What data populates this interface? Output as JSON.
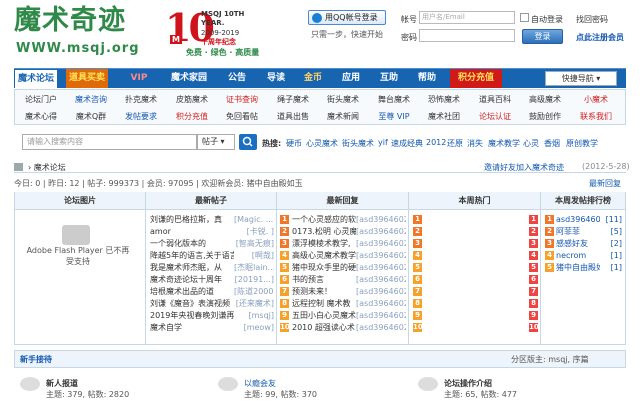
{
  "header": {
    "logo_cn": "魔术奇迹",
    "logo_url": "WWW.msqj.org",
    "anniv_num": "10",
    "anniv_m": "M",
    "anniv_t1": "MSQJ 10TH",
    "anniv_t2": "YEAR.",
    "anniv_t3": "2009-2019",
    "anniv_t4": "十周年纪念",
    "anniv_slogan": "免费 · 绿色 · 高质量",
    "qq_login": "用QQ帐号登录",
    "qq_hint": "只需一步，快速开始",
    "account_label": "帐号",
    "account_placeholder": "用户名/Email",
    "auto_login": "自动登录",
    "forgot": "找回密码",
    "password_label": "密码",
    "login_btn": "登录",
    "register": "点此注册会员"
  },
  "nav": {
    "items": [
      "魔术论坛",
      "道具买卖",
      "VIP",
      "魔术家园",
      "公告",
      "导读",
      "金币",
      "应用",
      "互助",
      "帮助",
      "积分充值"
    ],
    "quick": "快捷导航"
  },
  "subnav": {
    "row1": [
      "论坛门户",
      "魔术咨询",
      "扑克魔术",
      "皮筋魔术",
      "证书查询",
      "绳子魔术",
      "街头魔术",
      "舞台魔术",
      "恐怖魔术",
      "道具百科",
      "高级魔术",
      "小魔术"
    ],
    "row2": [
      "魔术心得",
      "魔术Q群",
      "发帖要求",
      "积分充值",
      "免回看帖",
      "道具出售",
      "魔术新闻",
      "至尊 VIP",
      "魔术社团",
      "论坛认证",
      "鼓励创作",
      "联系我们"
    ]
  },
  "search": {
    "placeholder": "请输入搜索内容",
    "type": "帖子",
    "hot_label": "热搜:",
    "hot": [
      "硬币",
      "心灵魔术",
      "街头魔术",
      "yif",
      "速成经典",
      "2012",
      "还原",
      "消失",
      "魔术教学",
      "心灵",
      "香烟",
      "原创教学"
    ]
  },
  "breadcrumb": {
    "path": "魔术论坛",
    "invite": "邀请好友加入魔术奇迹",
    "date": "(2012-5-28)"
  },
  "stats": {
    "text": "今日: 0 | 昨日: 12 | 帖子: 999373 | 会员: 97095 | 欢迎新会员: 猪中自由殿如玉",
    "latest": "最新回复"
  },
  "columns": [
    "论坛图片",
    "最新帖子",
    "最新回复",
    "本周热门",
    "本周发帖排行榜"
  ],
  "flash": "Adobe Flash Player 已不再受支持",
  "latest_posts": [
    {
      "t": "刘谦的巴格拉斯，真",
      "a": "[Magic. ...]"
    },
    {
      "t": "amor",
      "a": "[卡锐. ]"
    },
    {
      "t": "一个弱化版本的",
      "a": "[智高无痕]"
    },
    {
      "t": "降越5年的语言,关于语言.",
      "a": "[啊哉]"
    },
    {
      "t": "我是魔术师杰眠，从",
      "a": "[杰眠lain...]"
    },
    {
      "t": "魔术奇迹论坛十周年",
      "a": "[20191...]"
    },
    {
      "t": "培根魔术出品的道",
      "a": "[陈道2000]"
    },
    {
      "t": "刘谦《魔音》表演视频",
      "a": "[还来魔术]"
    },
    {
      "t": "2019年央视春晚刘谦再登.",
      "a": "[msqj]"
    },
    {
      "t": "魔术自学",
      "a": "[meow]"
    }
  ],
  "latest_replies": [
    {
      "t": "一个心灵感应的软",
      "a": "[asd39646026]"
    },
    {
      "t": "0173.松明 心灵魔",
      "a": "[asd39646026]"
    },
    {
      "t": "漂浮模棱术教学,",
      "a": "[asd39646026]"
    },
    {
      "t": "高级心灵魔术教学",
      "a": "[asd39646026]"
    },
    {
      "t": "猪中现众手里的硬",
      "a": "[asd39646026]"
    },
    {
      "t": "书的预言",
      "a": "[asd39646026]"
    },
    {
      "t": "预测未来！",
      "a": "[asd39646026]"
    },
    {
      "t": "远程控制 魔术教",
      "a": "[asd39646026]"
    },
    {
      "t": "五田小白心灵魔术",
      "a": "[asd39646026]"
    },
    {
      "t": "2010 超强读心术",
      "a": "[asd39646026]"
    }
  ],
  "ranking": [
    {
      "n": "asd39646026",
      "c": "[11]"
    },
    {
      "n": "阿菲菲",
      "c": "[5]"
    },
    {
      "n": "感感好友",
      "c": "[2]"
    },
    {
      "n": "necrom",
      "c": "[1]"
    },
    {
      "n": "猪中自由殿如",
      "c": "[1]"
    }
  ],
  "section": {
    "title": "新手接待",
    "moderator": "分区版主: msqj, 序篇"
  },
  "forums": [
    {
      "name": "新人报道",
      "stat": "主题: 379, 帖数: 2820"
    },
    {
      "name": "以瘾会友",
      "stat": "主题: 99, 帖数: 370"
    },
    {
      "name": "论坛操作介绍",
      "stat": "主题: 65, 帖数: 477"
    }
  ]
}
